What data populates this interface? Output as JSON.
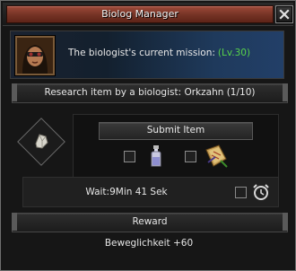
{
  "window": {
    "title": "Biolog Manager"
  },
  "mission": {
    "text": "The biologist's current mission:",
    "level": "(Lv.30)"
  },
  "research": {
    "header": "Research item by a biologist: Orkzahn (1/10)",
    "submit_label": "Submit Item",
    "wait_text": "Wait:9Min 41 Sek"
  },
  "reward": {
    "header": "Reward",
    "value": "Beweglichkeit +60"
  },
  "colors": {
    "level_green": "#57d24a",
    "title_red": "#743224"
  },
  "icons": [
    "close-icon",
    "biologist-portrait",
    "orkzahn-item-icon",
    "potion-bottle-icon",
    "scroll-map-icon",
    "alarm-clock-icon"
  ]
}
